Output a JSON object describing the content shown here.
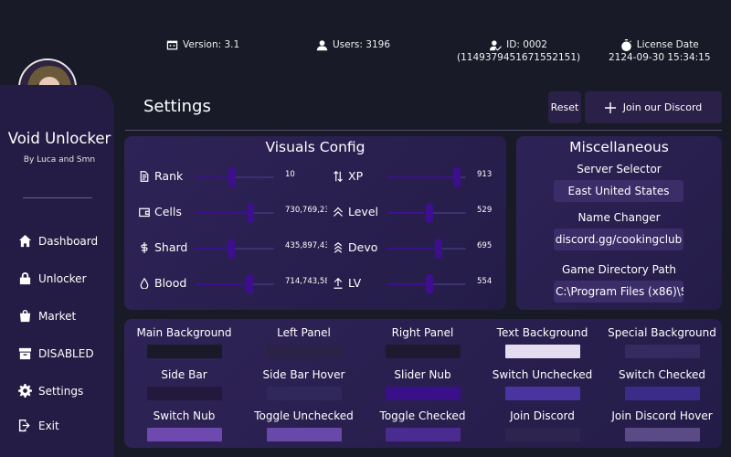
{
  "info": {
    "version": "Version: 3.1",
    "users": "Users: 3196",
    "id": "ID: 0002",
    "id_sub": "(1149379451671552151)",
    "license": "License Date",
    "license_sub": "2124-09-30 15:34:15"
  },
  "sidebar": {
    "brand": "Void Unlocker",
    "byline": "By Luca and Smn",
    "items": [
      {
        "label": "Dashboard",
        "icon": "home-icon"
      },
      {
        "label": "Unlocker",
        "icon": "lock-icon"
      },
      {
        "label": "Market",
        "icon": "bag-icon"
      },
      {
        "label": "DISABLED",
        "icon": "box-icon"
      },
      {
        "label": "Settings",
        "icon": "gear-icon"
      },
      {
        "label": "Exit",
        "icon": "exit-icon"
      }
    ]
  },
  "header": {
    "title": "Settings",
    "reset_label": "Reset",
    "discord_label": "Join our Discord"
  },
  "visuals": {
    "title": "Visuals Config",
    "sliders": [
      {
        "label": "Rank",
        "value": "10",
        "fraction": 0.47,
        "icon": "document-icon"
      },
      {
        "label": "Cells",
        "value": "730,769,23",
        "fraction": 0.7,
        "icon": "wallet-icon"
      },
      {
        "label": "Shard",
        "value": "435,897,43",
        "fraction": 0.45,
        "icon": "dollar-icon"
      },
      {
        "label": "Blood",
        "value": "714,743,58",
        "fraction": 0.69,
        "icon": "drop-icon"
      },
      {
        "label": "XP",
        "value": "913",
        "fraction": 0.88,
        "icon": "arrows-icon"
      },
      {
        "label": "Level",
        "value": "529",
        "fraction": 0.53,
        "icon": "chevrons-up-icon"
      },
      {
        "label": "Devo",
        "value": "695",
        "fraction": 0.65,
        "icon": "triple-chevron-icon"
      },
      {
        "label": "LV",
        "value": "554",
        "fraction": 0.54,
        "icon": "upload-icon"
      }
    ]
  },
  "misc": {
    "title": "Miscellaneous",
    "server_label": "Server Selector",
    "server_value": "East United States",
    "name_label": "Name Changer",
    "name_value": "discord.gg/cookingclub",
    "path_label": "Game Directory Path",
    "path_value": "C:\\Program Files (x86)\\S"
  },
  "colors": [
    {
      "label": "Main Background",
      "color": "#181a28"
    },
    {
      "label": "Left Panel",
      "color": "#2b2248"
    },
    {
      "label": "Right Panel",
      "color": "#1d1a30"
    },
    {
      "label": "Text Background",
      "color": "#e4ddf0"
    },
    {
      "label": "Special Background",
      "color": "#352b60"
    },
    {
      "label": "Side Bar",
      "color": "#23193d"
    },
    {
      "label": "Side Bar Hover",
      "color": "#30285a"
    },
    {
      "label": "Slider Nub",
      "color": "#3a0f8a"
    },
    {
      "label": "Switch Unchecked",
      "color": "#4a34a0"
    },
    {
      "label": "Switch Checked",
      "color": "#3c2c8a"
    },
    {
      "label": "Switch Nub",
      "color": "#6e4ab0"
    },
    {
      "label": "Toggle Unchecked",
      "color": "#6848a8"
    },
    {
      "label": "Toggle Checked",
      "color": "#4a2c90"
    },
    {
      "label": "Join Discord",
      "color": "#2e2450"
    },
    {
      "label": "Join Discord Hover",
      "color": "#5a4b86"
    }
  ]
}
